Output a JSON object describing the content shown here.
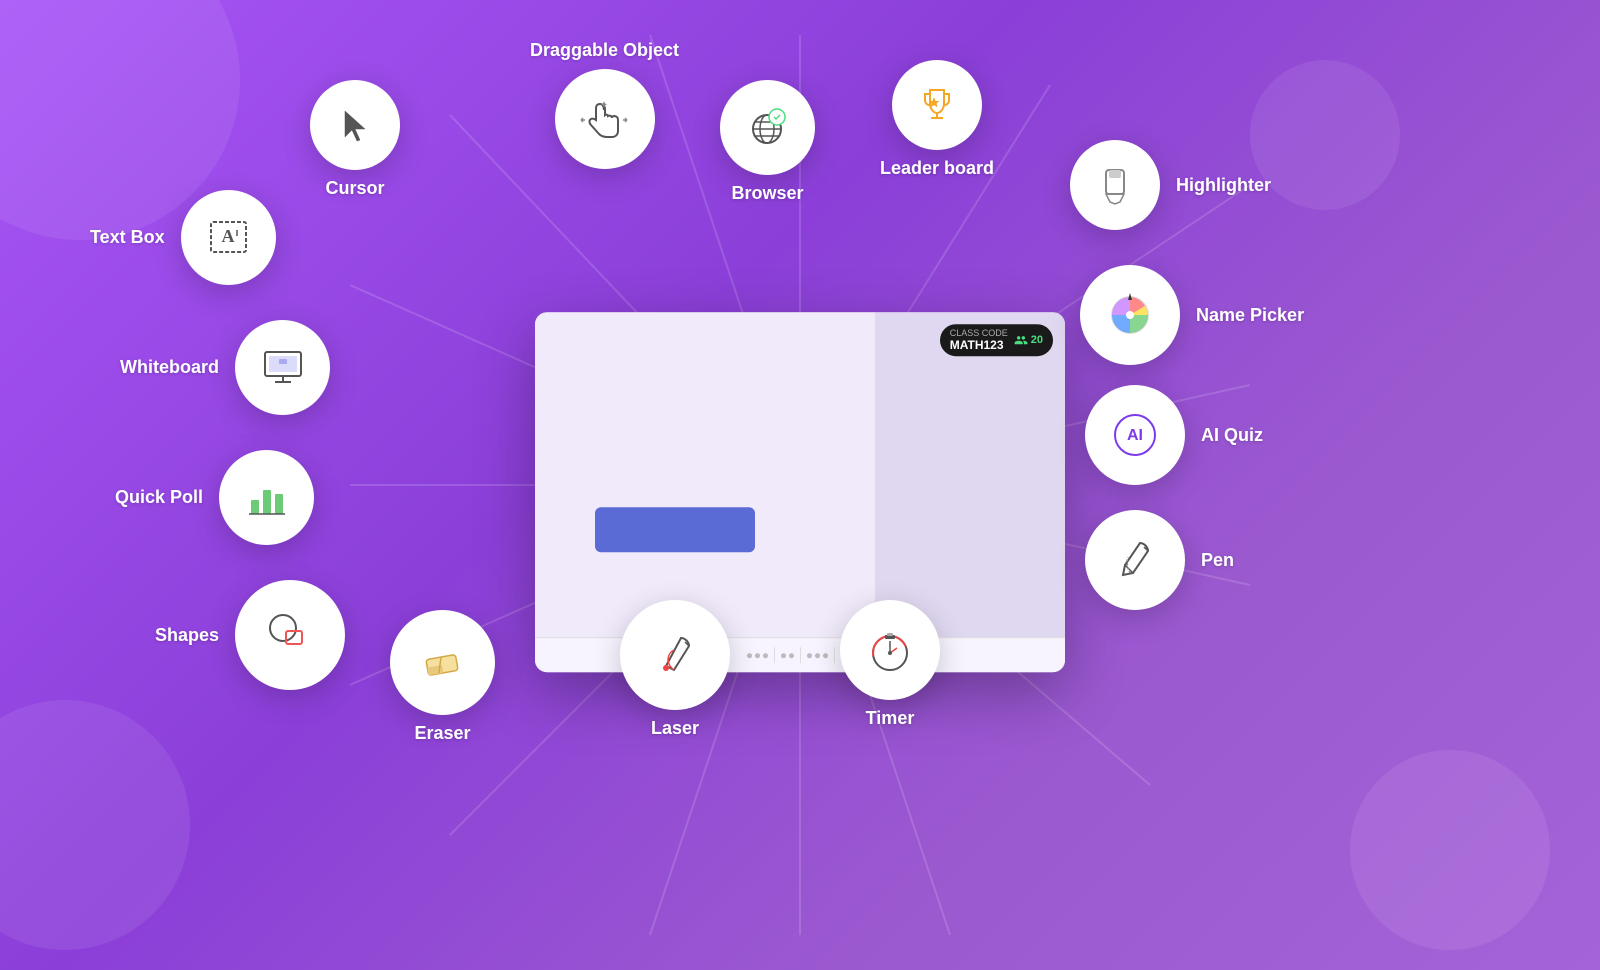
{
  "background": {
    "color": "#9b59d0"
  },
  "features": [
    {
      "id": "cursor",
      "label": "Cursor",
      "icon": "cursor"
    },
    {
      "id": "draggable",
      "label": "Draggable Object",
      "icon": "draggable"
    },
    {
      "id": "browser",
      "label": "Browser",
      "icon": "browser"
    },
    {
      "id": "leaderboard",
      "label": "Leader board",
      "icon": "leaderboard"
    },
    {
      "id": "highlighter",
      "label": "Highlighter",
      "icon": "highlighter"
    },
    {
      "id": "textbox",
      "label": "Text Box",
      "icon": "textbox"
    },
    {
      "id": "whiteboard",
      "label": "Whiteboard",
      "icon": "whiteboard"
    },
    {
      "id": "namepicker",
      "label": "Name Picker",
      "icon": "namepicker"
    },
    {
      "id": "aiquiz",
      "label": "AI Quiz",
      "icon": "aiquiz"
    },
    {
      "id": "quickpoll",
      "label": "Quick Poll",
      "icon": "quickpoll"
    },
    {
      "id": "shapes",
      "label": "Shapes",
      "icon": "shapes"
    },
    {
      "id": "pen",
      "label": "Pen",
      "icon": "pen"
    },
    {
      "id": "eraser",
      "label": "Eraser",
      "icon": "eraser"
    },
    {
      "id": "laser",
      "label": "Laser",
      "icon": "laser"
    },
    {
      "id": "timer",
      "label": "Timer",
      "icon": "timer"
    }
  ],
  "whiteboard": {
    "class_code_label": "CLASS CODE",
    "class_code": "MATH123",
    "users_count": "20"
  }
}
